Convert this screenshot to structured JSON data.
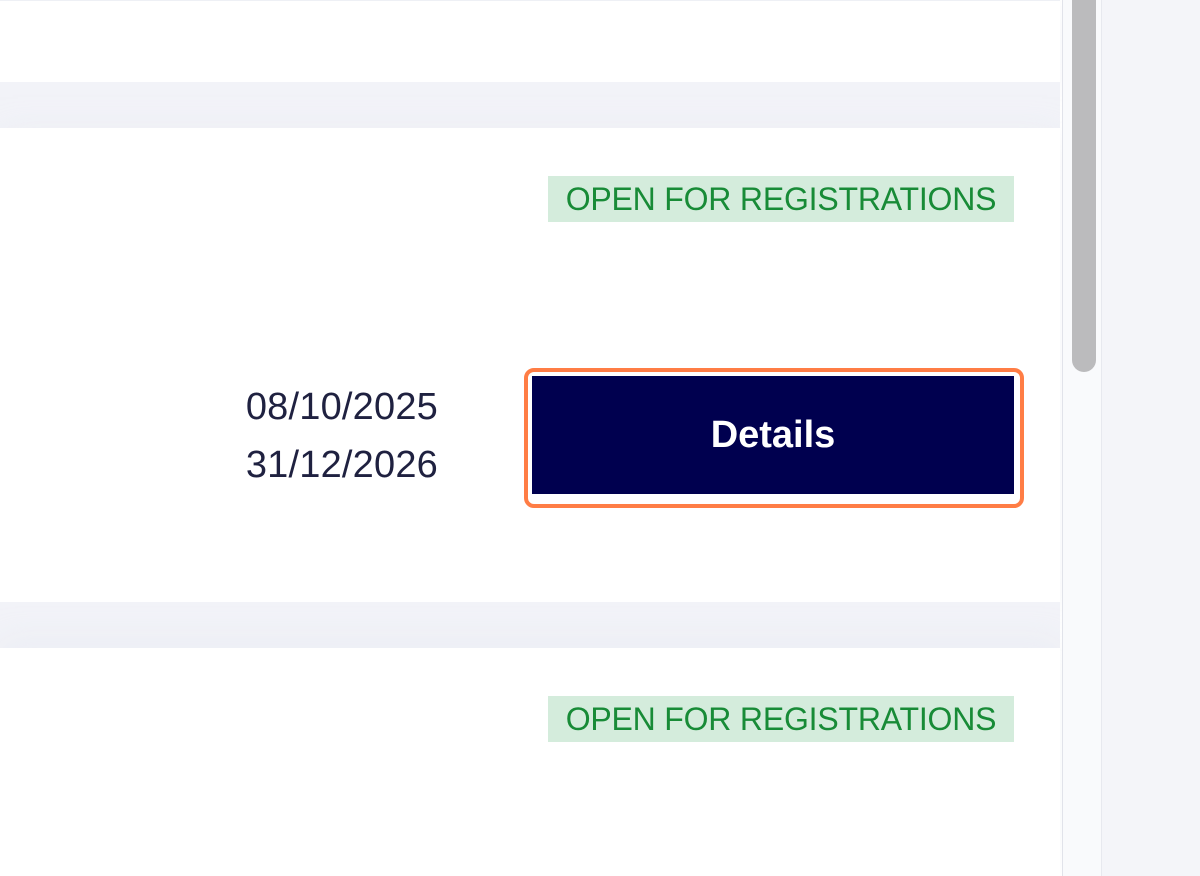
{
  "listing": {
    "status_label_top": "OPEN FOR REGISTRATIONS",
    "start_date": "08/10/2025",
    "end_date": "31/12/2026",
    "details_button_label": "Details",
    "status_label_bottom": "OPEN FOR REGISTRATIONS"
  },
  "colors": {
    "status_text": "#188b37",
    "status_background": "#d4ecdc",
    "button_background": "#00004f",
    "focus_ring": "#ff7d45"
  }
}
